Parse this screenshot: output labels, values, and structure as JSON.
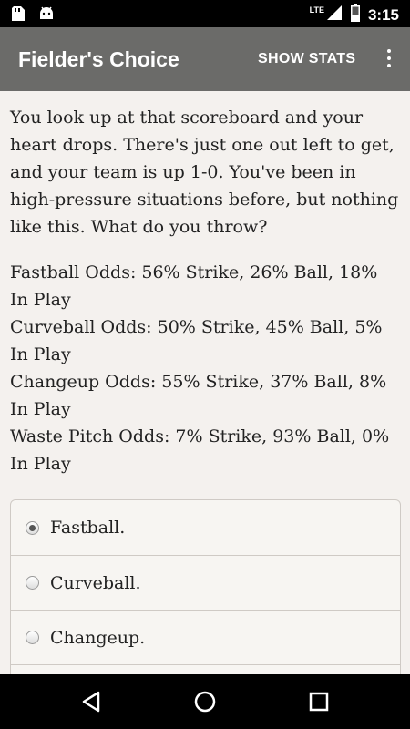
{
  "status_bar": {
    "time": "3:15",
    "network": "LTE",
    "icons": [
      "sd-card-icon",
      "android-icon",
      "signal-icon",
      "battery-icon"
    ]
  },
  "app_bar": {
    "title": "Fielder's Choice",
    "action_label": "SHOW STATS",
    "overflow_icon": "more-vert-icon"
  },
  "story": "You look up at that scoreboard and your heart drops. There's just one out left to get, and your team is up 1-0. You've been in high-pressure situations before, but nothing like this. What do you throw?",
  "odds": [
    "Fastball Odds: 56% Strike, 26% Ball, 18% In Play",
    "Curveball Odds: 50% Strike, 45% Ball, 5% In Play",
    "Changeup Odds: 55% Strike, 37% Ball, 8% In Play",
    "Waste Pitch Odds: 7% Strike, 93% Ball, 0% In Play"
  ],
  "choices": [
    {
      "label": "Fastball.",
      "selected": true
    },
    {
      "label": "Curveball.",
      "selected": false
    },
    {
      "label": "Changeup.",
      "selected": false
    },
    {
      "label": "",
      "selected": false
    }
  ],
  "nav": [
    "back-icon",
    "home-icon",
    "recents-icon"
  ]
}
